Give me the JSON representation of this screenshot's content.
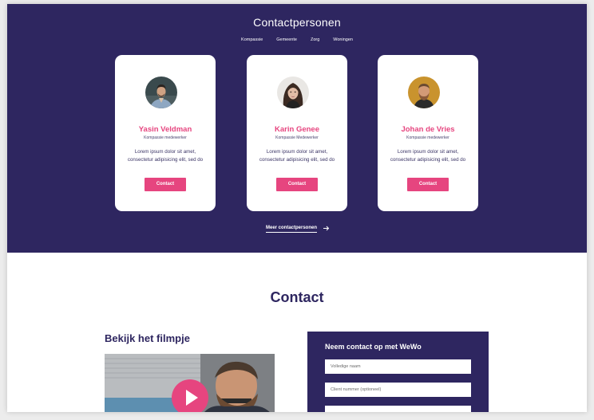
{
  "hero": {
    "title": "Contactpersonen",
    "nav": [
      "Kompassie",
      "Gemeente",
      "Zorg",
      "Woningen"
    ],
    "more_link": "Meer contactpersonen"
  },
  "cards": [
    {
      "name": "Yasin Veldman",
      "role": "Kompassie medewerker",
      "text": "Lorem ipsum dolor sit amet, consectetur adipisicing elit, sed do",
      "button": "Contact"
    },
    {
      "name": "Karin Genee",
      "role": "Kompassie Medewerker",
      "text": "Lorem ipsum dolor sit amet, consectetur adipisicing elit, sed do",
      "button": "Contact"
    },
    {
      "name": "Johan de Vries",
      "role": "Kompassie medewerker",
      "text": "Lorem ipsum dolor sit amet, consectetur adipisicing elit, sed do",
      "button": "Contact"
    }
  ],
  "contact": {
    "title": "Contact",
    "video_heading": "Bekijk het filmpje",
    "form": {
      "title": "Neem contact op met WeWo",
      "fields": [
        {
          "placeholder": "Volledige naam"
        },
        {
          "placeholder": "Client nummer (optioneel)"
        },
        {
          "placeholder": ""
        }
      ]
    }
  },
  "colors": {
    "primary": "#2e2660",
    "accent": "#e6457f",
    "background": "#ffffff"
  },
  "icons": {
    "more_arrow": "arrow-right-icon",
    "video_play": "play-icon"
  }
}
